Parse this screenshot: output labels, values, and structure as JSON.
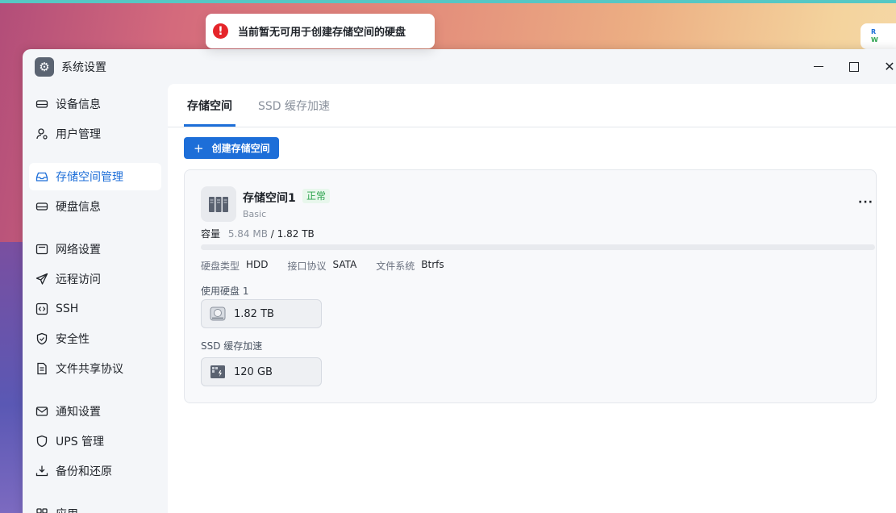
{
  "toast": {
    "message": "当前暂无可用于创建存储空间的硬盘",
    "icon": "error-icon"
  },
  "desk_widget": {
    "line1": "R",
    "line2": "W"
  },
  "window": {
    "title": "系统设置",
    "icon": "gear-icon"
  },
  "sidebar": {
    "items": [
      {
        "label": "设备信息",
        "icon": "device-icon"
      },
      {
        "label": "用户管理",
        "icon": "user-icon"
      },
      {
        "label": "存储空间管理",
        "icon": "storage-icon",
        "active": true
      },
      {
        "label": "硬盘信息",
        "icon": "disk-icon"
      },
      {
        "label": "网络设置",
        "icon": "network-icon"
      },
      {
        "label": "远程访问",
        "icon": "send-icon"
      },
      {
        "label": "SSH",
        "icon": "code-icon"
      },
      {
        "label": "安全性",
        "icon": "shield-icon"
      },
      {
        "label": "文件共享协议",
        "icon": "document-icon"
      },
      {
        "label": "通知设置",
        "icon": "mail-icon"
      },
      {
        "label": "UPS 管理",
        "icon": "ups-shield-icon"
      },
      {
        "label": "备份和还原",
        "icon": "backup-icon"
      },
      {
        "label": "应用",
        "icon": "apps-icon"
      }
    ]
  },
  "tabs": [
    {
      "label": "存储空间",
      "active": true
    },
    {
      "label": "SSD 缓存加速",
      "active": false
    }
  ],
  "create_button": {
    "label": "创建存储空间"
  },
  "volume": {
    "name": "存储空间1",
    "status": "正常",
    "type": "Basic",
    "capacity_label": "容量",
    "used": "5.84 MB",
    "total": "/ 1.82 TB",
    "used_fraction": 0.0,
    "props": [
      {
        "label": "硬盘类型",
        "value": "HDD"
      },
      {
        "label": "接口协议",
        "value": "SATA"
      },
      {
        "label": "文件系统",
        "value": "Btrfs"
      }
    ],
    "disks_label": "使用硬盘 1",
    "disk_size": "1.82 TB",
    "ssd_label": "SSD 缓存加速",
    "ssd_size": "120 GB"
  },
  "colors": {
    "accent": "#1d6ed8",
    "status_ok": "#2ea44f",
    "error": "#e5252a"
  }
}
